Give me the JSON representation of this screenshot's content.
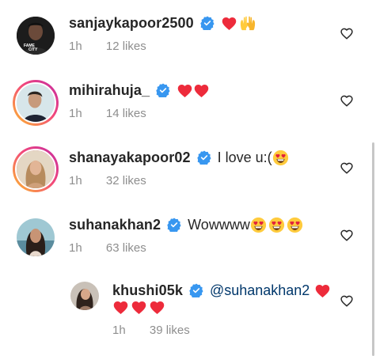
{
  "comments": [
    {
      "username": "sanjaykapoor2500",
      "text": "",
      "time": "1h",
      "likes": "12 likes",
      "emoji": [
        "red-heart-emoji",
        "raised-hands-emoji"
      ]
    },
    {
      "username": "mihirahuja_",
      "text": "",
      "time": "1h",
      "likes": "14 likes",
      "emoji": [
        "red-heart-emoji",
        "red-heart-emoji"
      ]
    },
    {
      "username": "shanayakapoor02",
      "text": "I love u:(",
      "time": "1h",
      "likes": "32 likes",
      "emoji": [
        "heart-eyes-emoji"
      ]
    },
    {
      "username": "suhanakhan2",
      "text": "Wowwww",
      "time": "1h",
      "likes": "63 likes",
      "emoji": [
        "heart-eyes-emoji",
        "heart-eyes-emoji",
        "heart-eyes-emoji"
      ]
    }
  ],
  "reply": {
    "username": "khushi05k",
    "mention": "@suhanakhan2",
    "time": "1h",
    "likes": "39 likes",
    "emoji": [
      "red-heart-emoji",
      "red-heart-emoji",
      "red-heart-emoji",
      "red-heart-emoji"
    ]
  },
  "avatar_texts": {
    "fame": "FAME",
    "city": "CITY"
  },
  "colors": {
    "verified": "#3897f0",
    "heart": "#ed2b3b",
    "story_ring_start": "#f9c74f",
    "story_ring_end": "#d6249f",
    "meta": "#8e8e8e",
    "mention": "#00376b"
  }
}
